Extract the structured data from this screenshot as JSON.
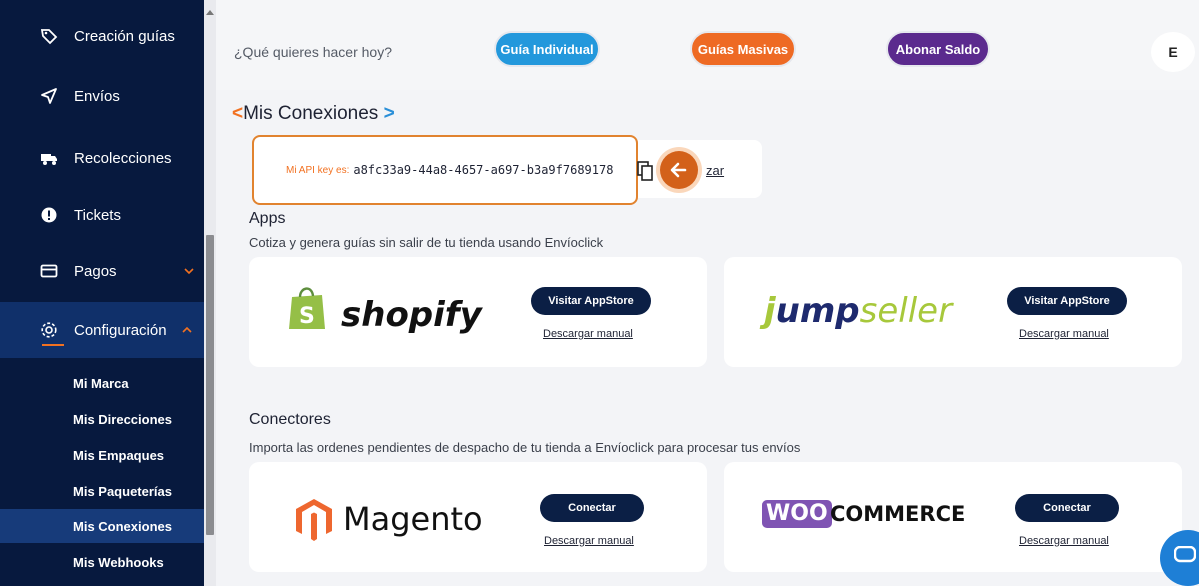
{
  "sidebar": {
    "items": [
      {
        "label": "Creación guías",
        "icon": "tag-icon"
      },
      {
        "label": "Envíos",
        "icon": "send-icon"
      },
      {
        "label": "Recolecciones",
        "icon": "truck-icon"
      },
      {
        "label": "Tickets",
        "icon": "alert-icon"
      },
      {
        "label": "Pagos",
        "icon": "card-icon"
      },
      {
        "label": "Configuración",
        "icon": "gear-icon"
      }
    ],
    "subitems": [
      "Mi Marca",
      "Mis Direcciones",
      "Mis Empaques",
      "Mis Paqueterías",
      "Mis Conexiones",
      "Mis Webhooks"
    ],
    "active_subitem": "Mis Conexiones"
  },
  "topbar": {
    "prompt": "¿Qué quieres hacer hoy?",
    "buttons": [
      "Guía Individual",
      "Guías Masivas",
      "Abonar Saldo"
    ],
    "avatar_letter": "E"
  },
  "page": {
    "title_prefix": "<",
    "title": "Mis Conexiones",
    "title_suffix": ">",
    "api_label": "Mi API key es:",
    "api_key": "a8fc33a9-44a8-4657-a697-b3a9f7689178",
    "regen_link": "zar"
  },
  "apps": {
    "heading": "Apps",
    "description": "Cotiza y genera guías sin salir de tu tienda usando Envíoclick",
    "cards": [
      {
        "logo": "shopify",
        "button": "Visitar AppStore",
        "link": "Descargar manual"
      },
      {
        "logo_part1": "j",
        "logo_part2": "ump",
        "logo_part3": "seller",
        "button": "Visitar AppStore",
        "link": "Descargar manual"
      }
    ]
  },
  "connectors": {
    "heading": "Conectores",
    "description": "Importa las ordenes pendientes de despacho de tu tienda a Envíoclick para procesar tus envíos",
    "cards": [
      {
        "logo": "Magento",
        "button": "Conectar",
        "link": "Descargar manual"
      },
      {
        "logo_part1": "WOO",
        "logo_part2": "COMMERCE",
        "button": "Conectar",
        "link": "Descargar manual"
      }
    ]
  },
  "colors": {
    "sidebar": "#07193e",
    "accent_orange": "#f27121",
    "guia_individual": "#2398dc",
    "guias_masivas": "#ee6a24",
    "abonar_saldo": "#5b2a8e",
    "shopify_green": "#95bf47",
    "jumpseller_green": "#a7c83b",
    "magento_orange": "#ee672f",
    "woo_purple": "#7f54b3"
  }
}
